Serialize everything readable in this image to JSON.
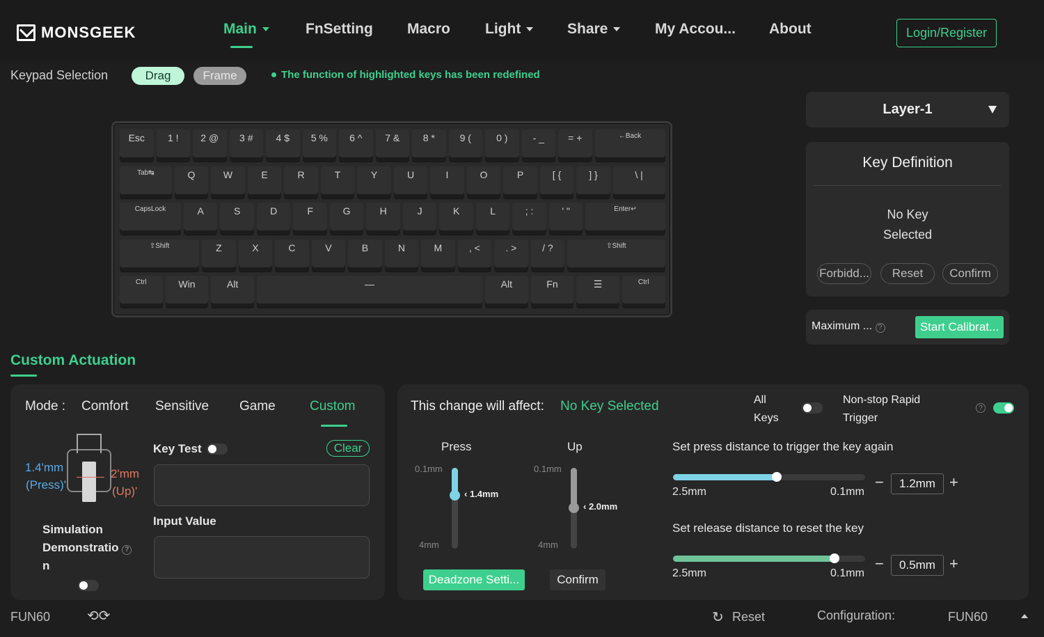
{
  "nav": {
    "logo": "MONSGEEK",
    "items": [
      {
        "label": "Main",
        "dropdown": true,
        "active": true
      },
      {
        "label": "FnSetting",
        "dropdown": false
      },
      {
        "label": "Macro",
        "dropdown": false
      },
      {
        "label": "Light",
        "dropdown": true
      },
      {
        "label": "Share",
        "dropdown": true
      },
      {
        "label": "My Accou...",
        "dropdown": false
      },
      {
        "label": "About",
        "dropdown": false
      }
    ],
    "login_label": "Login/Register"
  },
  "keypad": {
    "label": "Keypad Selection",
    "drag_label": "Drag",
    "frame_label": "Frame",
    "notice": "The function of highlighted keys has been redefined"
  },
  "keyboard": {
    "rows": [
      [
        "Esc",
        "1 !",
        "2 @",
        "3 #",
        "4 $",
        "5 %",
        "6 ^",
        "7 &",
        "8 *",
        "9 (",
        "0 )",
        "- _",
        "= +",
        "←Back"
      ],
      [
        "Tab↹",
        "Q",
        "W",
        "E",
        "R",
        "T",
        "Y",
        "U",
        "I",
        "O",
        "P",
        "[ {",
        "] }",
        "\\ |"
      ],
      [
        "CapsLock",
        "A",
        "S",
        "D",
        "F",
        "G",
        "H",
        "J",
        "K",
        "L",
        "; :",
        "' \"",
        "Enter↵"
      ],
      [
        "⇧Shift",
        "Z",
        "X",
        "C",
        "V",
        "B",
        "N",
        "M",
        ", <",
        ". >",
        "/ ?",
        "⇧Shift"
      ],
      [
        "Ctrl",
        "Win",
        "Alt",
        "—",
        "Alt",
        "Fn",
        "☰",
        "Ctrl"
      ]
    ]
  },
  "layer": {
    "label": "Layer-1"
  },
  "key_definition": {
    "title": "Key Definition",
    "empty_line1": "No Key",
    "empty_line2": "Selected",
    "forbid_label": "Forbidd...",
    "reset_label": "Reset",
    "confirm_label": "Confirm"
  },
  "calibration": {
    "maximum_label": "Maximum ...",
    "start_label": "Start Calibrat..."
  },
  "custom_actuation": {
    "title": "Custom Actuation",
    "mode_label": "Mode :",
    "modes": [
      "Comfort",
      "Sensitive",
      "Game",
      "Custom"
    ],
    "active_mode": "Custom",
    "press_label_value": "1.4'mm",
    "press_label_word": "(Press)'",
    "up_label_value": "2'mm",
    "up_label_word": "(Up)'",
    "simulation_line1": "Simulation",
    "simulation_line2": "Demonstratio",
    "simulation_line3": "n",
    "simulation_on": false,
    "key_test_label": "Key Test",
    "key_test_on": false,
    "clear_label": "Clear",
    "input_value_label": "Input Value"
  },
  "affect": {
    "label": "This change will affect:",
    "value": "No Key Selected",
    "all_keys_line1": "All",
    "all_keys_line2": "Keys",
    "all_keys_on": false,
    "rapid_line1": "Non-stop Rapid",
    "rapid_line2": "Trigger",
    "rapid_on": true
  },
  "press_slider": {
    "title": "Press",
    "top_label": "0.1mm",
    "bottom_label": "4mm",
    "value_label": "1.4mm",
    "value": 1.4,
    "min": 0.1,
    "max": 4,
    "color": "#7fd3e6"
  },
  "up_slider": {
    "title": "Up",
    "top_label": "0.1mm",
    "bottom_label": "4mm",
    "value_label": "2.0mm",
    "value": 2.0,
    "min": 0.1,
    "max": 4,
    "color": "#9a9a9a"
  },
  "deadzone_label": "Deadzone Setti...",
  "confirm_label": "Confirm",
  "rapid_press": {
    "title": "Set press distance to trigger the key again",
    "left_label": "2.5mm",
    "right_label": "0.1mm",
    "value_text": "1.2mm",
    "fill_fraction": 0.54,
    "color": "#7fd3e6"
  },
  "rapid_release": {
    "title": "Set release distance to reset the key",
    "left_label": "2.5mm",
    "right_label": "0.1mm",
    "value_text": "0.5mm",
    "fill_fraction": 0.84,
    "color": "#6fc49a"
  },
  "footer": {
    "device": "FUN60",
    "reset_label": "Reset",
    "config_label": "Configuration:",
    "config_value": "FUN60"
  }
}
